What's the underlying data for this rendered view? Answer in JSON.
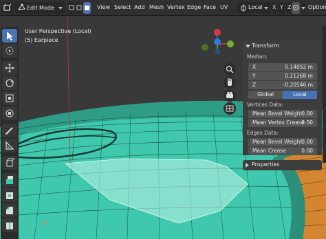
{
  "header": {
    "mode": "Edit Mode",
    "menus": [
      "View",
      "Select",
      "Add",
      "Mesh",
      "Vertex",
      "Edge",
      "Face",
      "UV"
    ],
    "orientation": "Local",
    "options_label": "Options"
  },
  "viewport": {
    "view_label": "User Perspective (Local)",
    "object_label": "(5) Earpiece"
  },
  "gizmo": {
    "x": "X",
    "y": "Y",
    "z": "Z"
  },
  "panel": {
    "transform": {
      "title": "Transform",
      "median_label": "Median:",
      "fields": [
        {
          "axis": "X",
          "value": "0.14052 m"
        },
        {
          "axis": "Y",
          "value": "0.21268 m"
        },
        {
          "axis": "Z",
          "value": "-0.20546 m"
        }
      ],
      "space": {
        "global": "Global",
        "local": "Local",
        "active": "Local"
      },
      "vertices_label": "Vertices Data:",
      "vertex_bevel": {
        "label": "Mean Bevel Weight",
        "value": "0.00"
      },
      "vertex_crease": {
        "label": "Mean Vertex Crease",
        "value": "0.00"
      },
      "edges_label": "Edges Data:",
      "edge_bevel": {
        "label": "Mean Bevel Weight",
        "value": "0.00"
      },
      "edge_crease": {
        "label": "Mean Crease",
        "value": "0.00"
      }
    },
    "properties": {
      "title": "Properties"
    }
  },
  "colors": {
    "accent": "#4772b3",
    "mesh": "#3ec9ad",
    "axis_x": "#d8394f",
    "axis_y": "#73b32f",
    "axis_z": "#2f79d8"
  }
}
